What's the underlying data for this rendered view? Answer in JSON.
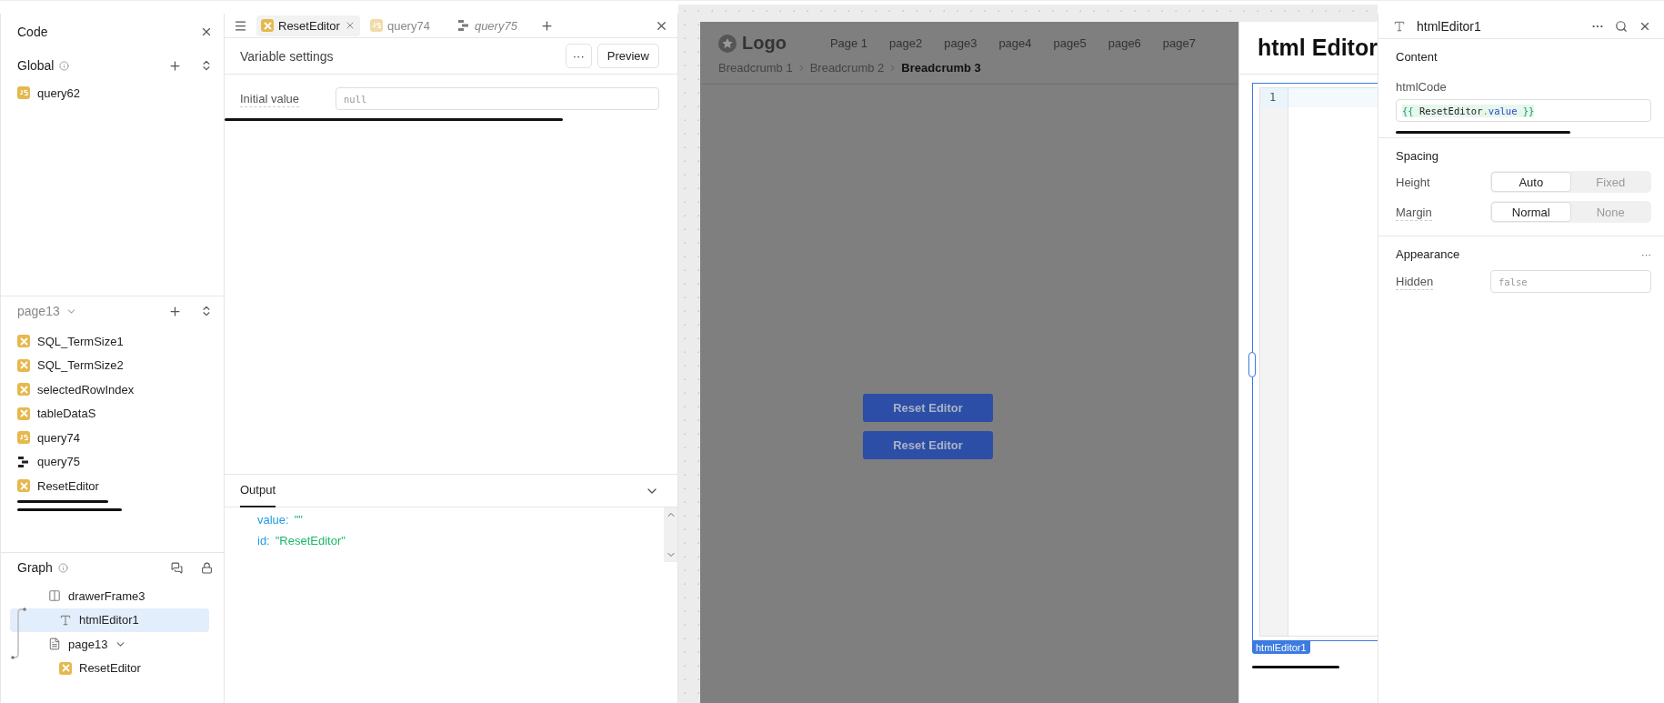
{
  "code_panel": {
    "title": "Code",
    "global": {
      "label": "Global",
      "items": [
        {
          "name": "query62",
          "kind": "js",
          "selected": false
        }
      ]
    },
    "page": {
      "label": "page13",
      "items": [
        {
          "name": "SQL_TermSize1",
          "kind": "variable",
          "selected": false
        },
        {
          "name": "SQL_TermSize2",
          "kind": "variable",
          "selected": false
        },
        {
          "name": "selectedRowIndex",
          "kind": "variable",
          "selected": false
        },
        {
          "name": "tableDataS",
          "kind": "variable",
          "selected": false
        },
        {
          "name": "query74",
          "kind": "js",
          "selected": false
        },
        {
          "name": "query75",
          "kind": "workflow",
          "selected": false
        },
        {
          "name": "ResetEditor",
          "kind": "variable",
          "selected": false
        }
      ]
    }
  },
  "graph": {
    "title": "Graph",
    "nodes": [
      {
        "name": "drawerFrame3",
        "kind": "frame",
        "selected": false,
        "children": [
          {
            "name": "htmlEditor1",
            "kind": "text",
            "selected": true
          }
        ]
      },
      {
        "name": "page13",
        "kind": "page",
        "selected": false,
        "children": [
          {
            "name": "ResetEditor",
            "kind": "variable",
            "selected": false
          }
        ]
      }
    ]
  },
  "editor": {
    "tabs": [
      {
        "label": "ResetEditor",
        "kind": "variable",
        "selected": true,
        "preview": false
      },
      {
        "label": "query74",
        "kind": "js",
        "selected": false,
        "preview": false
      },
      {
        "label": "query75",
        "kind": "workflow",
        "selected": false,
        "preview": true
      }
    ],
    "heading": "Variable settings",
    "more": "···",
    "preview_button": "Preview",
    "fields": [
      {
        "label": "Initial value",
        "placeholder": "null"
      }
    ],
    "output": {
      "tab": "Output",
      "lines": [
        {
          "key": "value:",
          "value": "\"\""
        },
        {
          "key": "id:",
          "value": "\"ResetEditor\""
        }
      ]
    }
  },
  "canvas": {
    "logo": "Logo",
    "nav": [
      "Page 1",
      "page2",
      "page3",
      "page4",
      "page5",
      "page6",
      "page7"
    ],
    "breadcrumbs": [
      {
        "label": "Breadcrumb 1",
        "current": false
      },
      {
        "label": "Breadcrumb 2",
        "current": false
      },
      {
        "label": "Breadcrumb 3",
        "current": true
      }
    ],
    "buttons": [
      "Reset Editor",
      "Reset Editor"
    ],
    "drawer": {
      "title": "html Editor",
      "line_numbers": [
        "1"
      ],
      "component_tag": "htmlEditor1"
    }
  },
  "inspector": {
    "title": "htmlEditor1",
    "more": "···",
    "content": {
      "label": "Content",
      "field_label": "htmlCode",
      "tokens": [
        {
          "text": "{{ ",
          "kind": "brace"
        },
        {
          "text": "ResetEditor",
          "kind": "ident"
        },
        {
          "text": ".",
          "kind": "dot"
        },
        {
          "text": "value",
          "kind": "prop"
        },
        {
          "text": " }}",
          "kind": "brace"
        }
      ]
    },
    "spacing": {
      "label": "Spacing",
      "rows": [
        {
          "label": "Height",
          "options": [
            {
              "label": "Auto",
              "selected": true
            },
            {
              "label": "Fixed",
              "selected": false
            }
          ]
        },
        {
          "label": "Margin",
          "options": [
            {
              "label": "Normal",
              "selected": true
            },
            {
              "label": "None",
              "selected": false
            }
          ]
        }
      ]
    },
    "appearance": {
      "label": "Appearance",
      "more": "···",
      "fields": [
        {
          "label": "Hidden",
          "placeholder": "false"
        }
      ]
    }
  }
}
